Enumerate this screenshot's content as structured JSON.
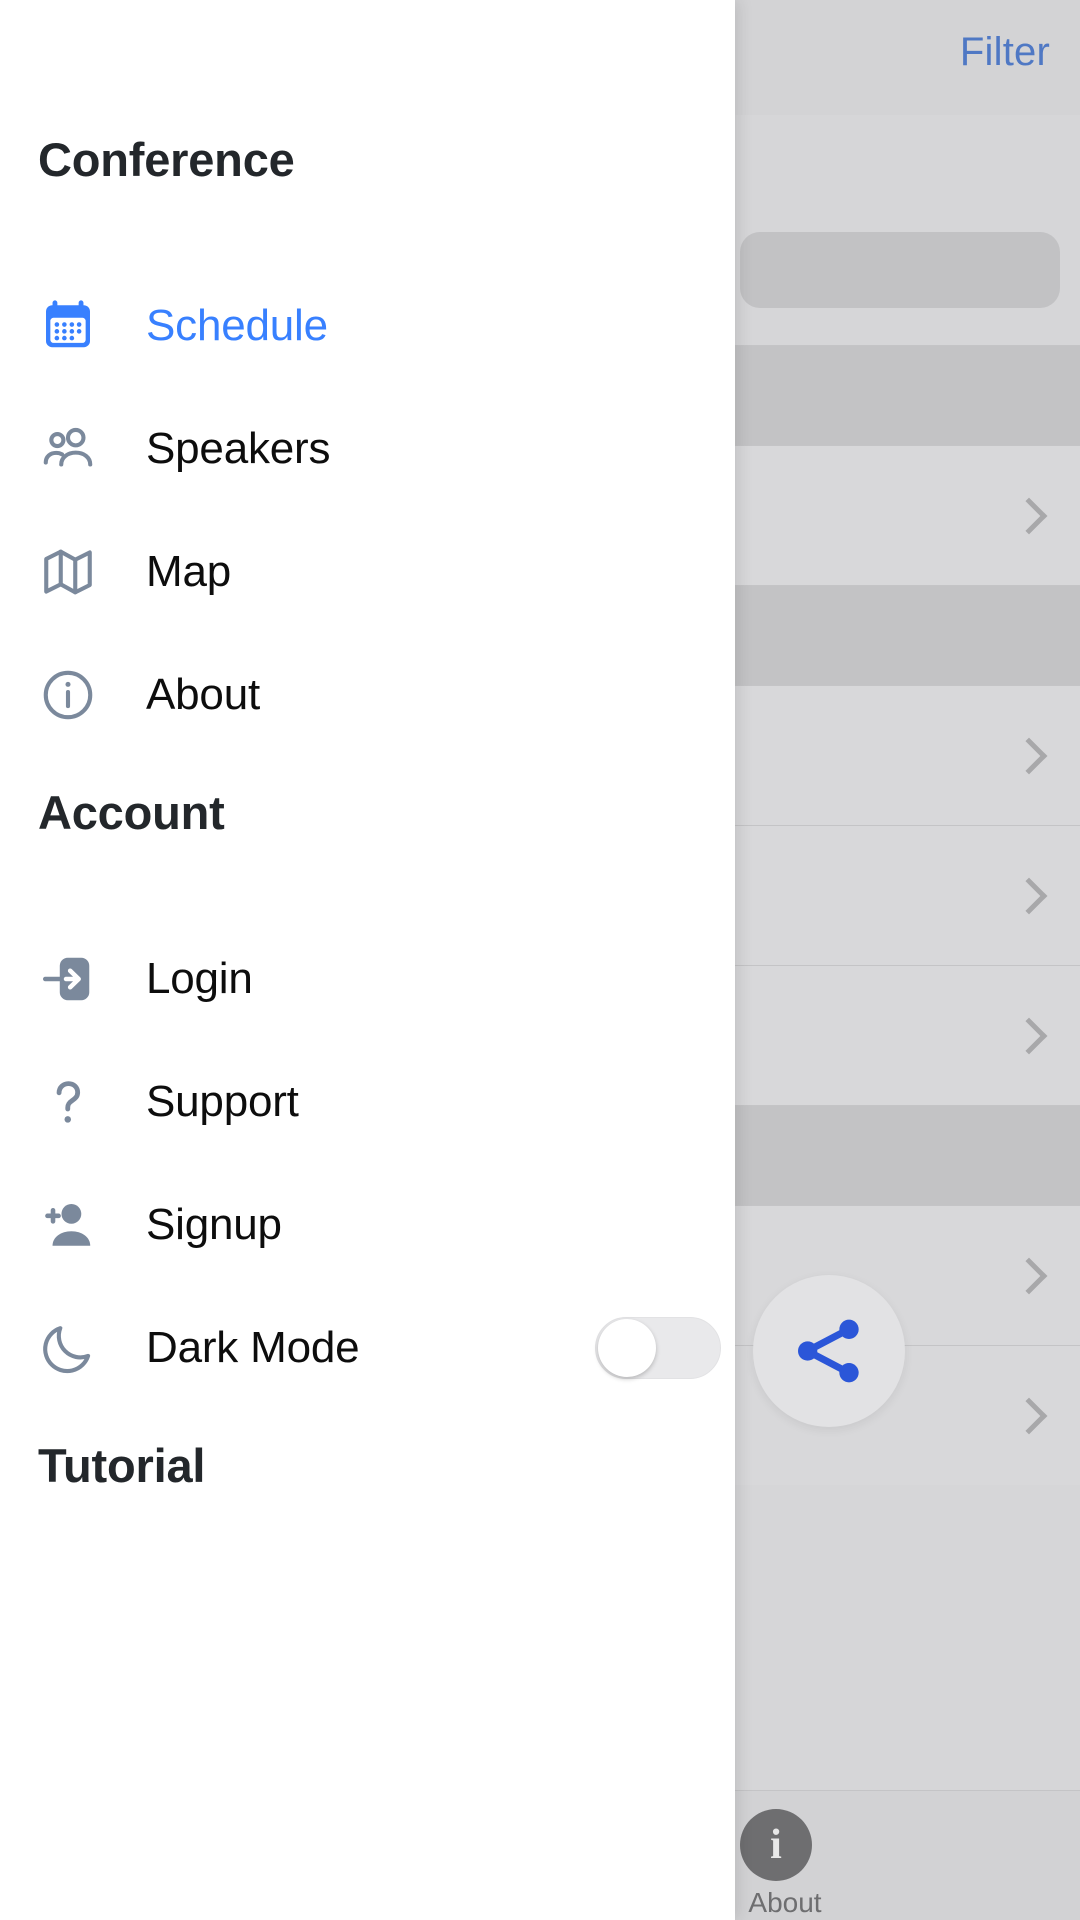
{
  "menu": {
    "sections": [
      {
        "title": "Conference",
        "items": [
          {
            "label": "Schedule",
            "icon": "calendar-icon",
            "active": true
          },
          {
            "label": "Speakers",
            "icon": "people-icon",
            "active": false
          },
          {
            "label": "Map",
            "icon": "map-icon",
            "active": false
          },
          {
            "label": "About",
            "icon": "information-circle-icon",
            "active": false
          }
        ]
      },
      {
        "title": "Account",
        "items": [
          {
            "label": "Login",
            "icon": "log-in-icon",
            "active": false
          },
          {
            "label": "Support",
            "icon": "help-icon",
            "active": false
          },
          {
            "label": "Signup",
            "icon": "person-add-icon",
            "active": false
          },
          {
            "label": "Dark Mode",
            "icon": "moon-icon",
            "active": false,
            "toggle": "off"
          }
        ]
      },
      {
        "title": "Tutorial",
        "items": []
      }
    ]
  },
  "backdrop": {
    "filter_label": "Filter",
    "tab_label": "About",
    "tab_icon": "i",
    "share_icon": "share-icon",
    "rows": [
      {
        "type": "head"
      },
      {
        "type": "item"
      },
      {
        "type": "head"
      },
      {
        "type": "item"
      },
      {
        "type": "item"
      },
      {
        "type": "item"
      },
      {
        "type": "head"
      },
      {
        "type": "item"
      },
      {
        "type": "item"
      }
    ]
  },
  "colors": {
    "accent": "#3880ff",
    "icon_muted": "#7b899c",
    "text": "#0d0d0d",
    "heading": "#23272b",
    "backdrop": "#d6d6d8"
  }
}
